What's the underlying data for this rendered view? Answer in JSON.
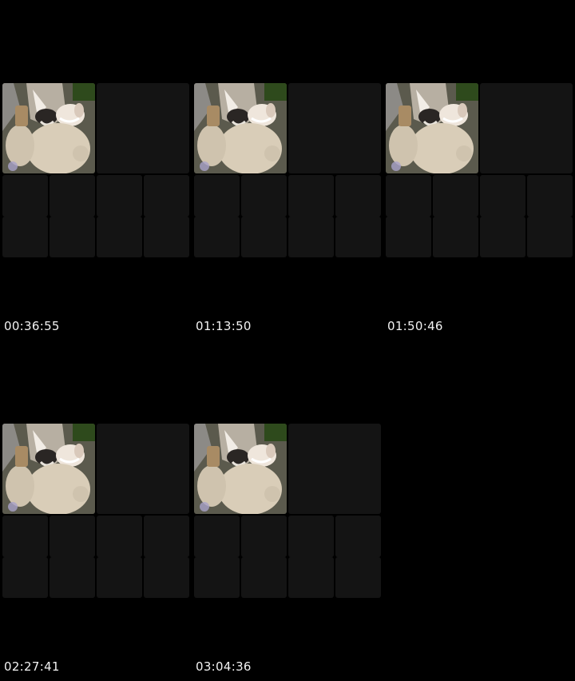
{
  "timestamps": [
    {
      "label": "00:36:55"
    },
    {
      "label": "01:13:50"
    },
    {
      "label": "01:50:46"
    },
    {
      "label": "02:27:41"
    },
    {
      "label": "03:04:36"
    }
  ],
  "thumbnail_subject": "wolf-and-sheep-selfie-image",
  "colors": {
    "background": "#000000",
    "tile": "#141414",
    "timestamp_text": "#f2f2f2"
  }
}
